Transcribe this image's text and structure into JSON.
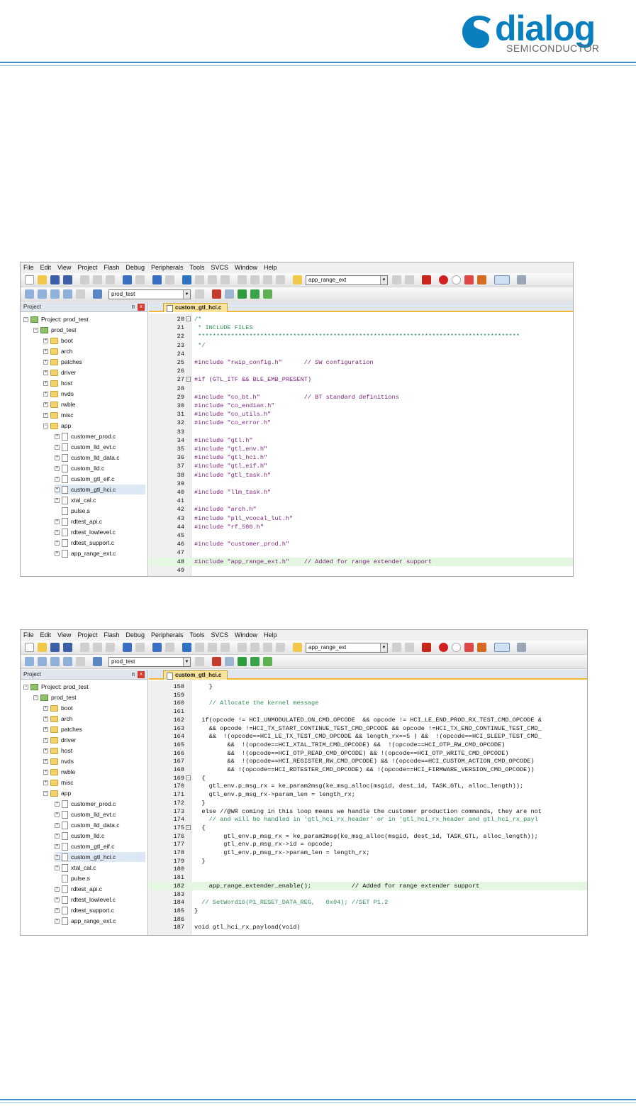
{
  "header": {
    "logo_word": "dialog",
    "logo_sub": "SEMICONDUCTOR",
    "brand_color": "#0a7fc0",
    "rule_color": "#3f8fcf"
  },
  "menu": [
    "File",
    "Edit",
    "View",
    "Project",
    "Flash",
    "Debug",
    "Peripherals",
    "Tools",
    "SVCS",
    "Window",
    "Help"
  ],
  "toolbar": {
    "target_combo": "app_range_ext",
    "project_combo": "prod_test"
  },
  "project_pane": {
    "title": "Project",
    "pin": "ᴨ",
    "close": "x",
    "root": "Project: prod_test",
    "target": "prod_test",
    "folders": [
      "boot",
      "arch",
      "patches",
      "driver",
      "host",
      "nvds",
      "rwble",
      "misc",
      "app"
    ],
    "app_files": [
      "customer_prod.c",
      "custom_lld_evt.c",
      "custom_lld_data.c",
      "custom_lld.c",
      "custom_gtl_eif.c",
      "custom_gtl_hci.c",
      "xtal_cal.c",
      "pulse.s",
      "rdtest_api.c",
      "rdtest_lowlevel.c",
      "rdtest_support.c",
      "app_range_ext.c"
    ],
    "selected": "custom_gtl_hci.c"
  },
  "editor_tab": "custom_gtl_hci.c",
  "screen1_code": [
    {
      "n": "20",
      "t": "/*",
      "fold": "−"
    },
    {
      "n": "21",
      "t": " * INCLUDE FILES"
    },
    {
      "n": "22",
      "t": " ****************************************************************************************"
    },
    {
      "n": "23",
      "t": " */"
    },
    {
      "n": "24",
      "t": ""
    },
    {
      "n": "25",
      "t": "#include \"rwip_config.h\"      // SW configuration"
    },
    {
      "n": "26",
      "t": ""
    },
    {
      "n": "27",
      "t": "#if (GTL_ITF && BLE_EMB_PRESENT)",
      "fold": "−"
    },
    {
      "n": "28",
      "t": ""
    },
    {
      "n": "29",
      "t": "#include \"co_bt.h\"            // BT standard definitions"
    },
    {
      "n": "30",
      "t": "#include \"co_endian.h\""
    },
    {
      "n": "31",
      "t": "#include \"co_utils.h\""
    },
    {
      "n": "32",
      "t": "#include \"co_error.h\""
    },
    {
      "n": "33",
      "t": ""
    },
    {
      "n": "34",
      "t": "#include \"gtl.h\""
    },
    {
      "n": "35",
      "t": "#include \"gtl_env.h\""
    },
    {
      "n": "36",
      "t": "#include \"gtl_hci.h\""
    },
    {
      "n": "37",
      "t": "#include \"gtl_eif.h\""
    },
    {
      "n": "38",
      "t": "#include \"gtl_task.h\""
    },
    {
      "n": "39",
      "t": ""
    },
    {
      "n": "40",
      "t": "#include \"llm_task.h\""
    },
    {
      "n": "41",
      "t": ""
    },
    {
      "n": "42",
      "t": "#include \"arch.h\""
    },
    {
      "n": "43",
      "t": "#include \"pll_vcocal_lut.h\""
    },
    {
      "n": "44",
      "t": "#include \"rf_580.h\""
    },
    {
      "n": "45",
      "t": ""
    },
    {
      "n": "46",
      "t": "#include \"customer_prod.h\""
    },
    {
      "n": "47",
      "t": ""
    },
    {
      "n": "48",
      "t": "#include \"app_range_ext.h\"    // Added for range extender support",
      "hl": true
    },
    {
      "n": "49",
      "t": ""
    }
  ],
  "screen2_code": [
    {
      "n": "158",
      "t": "    }"
    },
    {
      "n": "159",
      "t": ""
    },
    {
      "n": "160",
      "t": "    // Allocate the kernel message"
    },
    {
      "n": "161",
      "t": ""
    },
    {
      "n": "162",
      "t": "  if(opcode != HCI_UNMODULATED_ON_CMD_OPCODE  && opcode != HCI_LE_END_PROD_RX_TEST_CMD_OPCODE &"
    },
    {
      "n": "163",
      "t": "    && opcode !=HCI_TX_START_CONTINUE_TEST_CMD_OPCODE && opcode !=HCI_TX_END_CONTINUE_TEST_CMD_"
    },
    {
      "n": "164",
      "t": "    &&  !(opcode==HCI_LE_TX_TEST_CMD_OPCODE && length_rx==5 ) &&  !(opcode==HCI_SLEEP_TEST_CMD_"
    },
    {
      "n": "165",
      "t": "         &&  !(opcode==HCI_XTAL_TRIM_CMD_OPCODE) &&  !(opcode==HCI_OTP_RW_CMD_OPCODE)"
    },
    {
      "n": "166",
      "t": "         &&  !(opcode==HCI_OTP_READ_CMD_OPCODE) && !(opcode==HCI_OTP_WRITE_CMD_OPCODE)"
    },
    {
      "n": "167",
      "t": "         &&  !(opcode==HCI_REGISTER_RW_CMD_OPCODE) && !(opcode==HCI_CUSTOM_ACTION_CMD_OPCODE)"
    },
    {
      "n": "168",
      "t": "         && !(opcode==HCI_RDTESTER_CMD_OPCODE) && !(opcode==HCI_FIRMWARE_VERSION_CMD_OPCODE))"
    },
    {
      "n": "169",
      "t": "  {",
      "fold": "−"
    },
    {
      "n": "170",
      "t": "    gtl_env.p_msg_rx = ke_param2msg(ke_msg_alloc(msgid, dest_id, TASK_GTL, alloc_length));"
    },
    {
      "n": "171",
      "t": "    gtl_env.p_msg_rx->param_len = length_rx;"
    },
    {
      "n": "172",
      "t": "  }"
    },
    {
      "n": "173",
      "t": "  else //@WR coming in this loop means we handle the customer production commands, they are not"
    },
    {
      "n": "174",
      "t": "    // and will be handled in 'gtl_hci_rx_header' or in 'gtl_hci_rx_header and gtl_hci_rx_payl"
    },
    {
      "n": "175",
      "t": "  {",
      "fold": "−"
    },
    {
      "n": "176",
      "t": "        gtl_env.p_msg_rx = ke_param2msg(ke_msg_alloc(msgid, dest_id, TASK_GTL, alloc_length));"
    },
    {
      "n": "177",
      "t": "        gtl_env.p_msg_rx->id = opcode;"
    },
    {
      "n": "178",
      "t": "        gtl_env.p_msg_rx->param_len = length_rx;"
    },
    {
      "n": "179",
      "t": "  }"
    },
    {
      "n": "180",
      "t": ""
    },
    {
      "n": "181",
      "t": ""
    },
    {
      "n": "182",
      "t": "    app_range_extender_enable();           // Added for range extender support",
      "hl": true
    },
    {
      "n": "183",
      "t": ""
    },
    {
      "n": "184",
      "t": "  // SetWord16(P1_RESET_DATA_REG,   0x04); //SET P1.2"
    },
    {
      "n": "185",
      "t": "}"
    },
    {
      "n": "186",
      "t": ""
    },
    {
      "n": "187",
      "t": "void gtl_hci_rx_payload(void)"
    }
  ]
}
